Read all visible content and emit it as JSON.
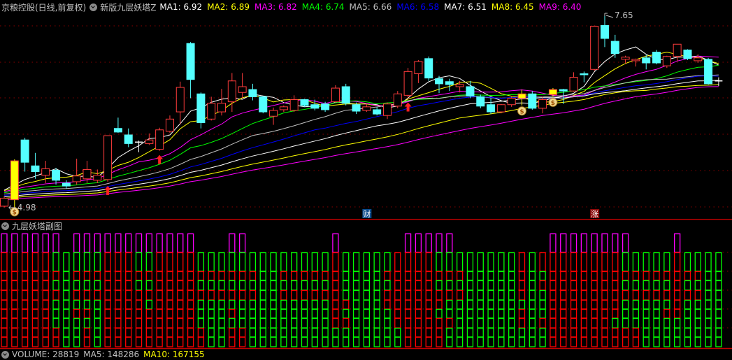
{
  "header": {
    "stock_title": "京粮控股(日线,前复权)",
    "indicator_name": "新版九层妖塔Z",
    "ma": [
      {
        "label": "MA1: 6.92",
        "color": "#ffffff"
      },
      {
        "label": "MA2: 6.89",
        "color": "#ffff00"
      },
      {
        "label": "MA3: 6.82",
        "color": "#ff00ff"
      },
      {
        "label": "MA4: 6.74",
        "color": "#00ff00"
      },
      {
        "label": "MA5: 6.66",
        "color": "#c0c0c0"
      },
      {
        "label": "MA6: 6.58",
        "color": "#0000ff"
      },
      {
        "label": "MA7: 6.51",
        "color": "#ffffff"
      },
      {
        "label": "MA8: 6.45",
        "color": "#ffff00"
      },
      {
        "label": "MA9: 6.40",
        "color": "#ff00ff"
      }
    ]
  },
  "main_chart": {
    "high_label": "7.65",
    "low_label": "4.98",
    "price_range": [
      4.95,
      7.86
    ],
    "ma_periods": [
      5,
      8,
      13,
      18,
      24,
      30,
      36,
      44,
      52
    ],
    "candles": [
      [
        5.0,
        5.14,
        4.98,
        5.11
      ],
      [
        5.09,
        5.65,
        4.98,
        5.63
      ],
      [
        5.92,
        5.95,
        5.48,
        5.61
      ],
      [
        5.56,
        5.74,
        5.38,
        5.48
      ],
      [
        5.43,
        5.63,
        5.32,
        5.52
      ],
      [
        5.5,
        5.53,
        5.3,
        5.36
      ],
      [
        5.32,
        5.36,
        5.24,
        5.28
      ],
      [
        5.34,
        5.66,
        5.3,
        5.42
      ],
      [
        5.38,
        5.63,
        5.32,
        5.51
      ],
      [
        5.36,
        5.51,
        5.32,
        5.43
      ],
      [
        5.37,
        5.98,
        5.34,
        5.98
      ],
      [
        6.08,
        6.23,
        6.02,
        6.03
      ],
      [
        5.99,
        6.08,
        5.82,
        5.87
      ],
      [
        5.89,
        5.91,
        5.75,
        5.89
      ],
      [
        5.87,
        6.01,
        5.85,
        5.92
      ],
      [
        5.79,
        6.09,
        5.77,
        6.06
      ],
      [
        6.04,
        6.26,
        6.02,
        6.21
      ],
      [
        6.31,
        6.73,
        6.14,
        6.65
      ],
      [
        7.26,
        7.28,
        6.5,
        6.76
      ],
      [
        6.56,
        6.58,
        6.08,
        6.16
      ],
      [
        6.21,
        6.52,
        6.19,
        6.43
      ],
      [
        6.31,
        6.63,
        6.26,
        6.43
      ],
      [
        6.45,
        6.85,
        6.31,
        6.74
      ],
      [
        6.58,
        6.85,
        6.5,
        6.66
      ],
      [
        6.62,
        6.7,
        6.47,
        6.52
      ],
      [
        6.52,
        6.53,
        6.29,
        6.31
      ],
      [
        6.25,
        6.37,
        6.13,
        6.33
      ],
      [
        6.34,
        6.4,
        6.31,
        6.38
      ],
      [
        6.33,
        6.54,
        6.31,
        6.48
      ],
      [
        6.48,
        6.49,
        6.38,
        6.4
      ],
      [
        6.41,
        6.48,
        6.33,
        6.36
      ],
      [
        6.42,
        6.45,
        6.31,
        6.34
      ],
      [
        6.45,
        6.68,
        6.44,
        6.64
      ],
      [
        6.66,
        6.7,
        6.4,
        6.43
      ],
      [
        6.41,
        6.44,
        6.28,
        6.32
      ],
      [
        6.33,
        6.42,
        6.31,
        6.38
      ],
      [
        6.34,
        6.38,
        6.26,
        6.28
      ],
      [
        6.26,
        6.44,
        6.21,
        6.42
      ],
      [
        6.39,
        6.6,
        6.36,
        6.56
      ],
      [
        6.54,
        6.92,
        6.5,
        6.87
      ],
      [
        6.84,
        7.03,
        6.71,
        7.01
      ],
      [
        7.05,
        7.08,
        6.74,
        6.78
      ],
      [
        6.77,
        6.81,
        6.57,
        6.7
      ],
      [
        6.73,
        6.77,
        6.6,
        6.69
      ],
      [
        6.66,
        6.74,
        6.58,
        6.69
      ],
      [
        6.66,
        6.74,
        6.5,
        6.53
      ],
      [
        6.52,
        6.55,
        6.36,
        6.39
      ],
      [
        6.41,
        6.5,
        6.28,
        6.31
      ],
      [
        6.31,
        6.42,
        6.29,
        6.41
      ],
      [
        6.41,
        6.52,
        6.38,
        6.5
      ],
      [
        6.5,
        6.62,
        6.4,
        6.56
      ],
      [
        6.56,
        6.6,
        6.34,
        6.36
      ],
      [
        6.36,
        6.52,
        6.29,
        6.48
      ],
      [
        6.55,
        6.64,
        6.52,
        6.62
      ],
      [
        6.62,
        6.63,
        6.42,
        6.6
      ],
      [
        6.6,
        6.86,
        6.59,
        6.79
      ],
      [
        6.84,
        6.87,
        6.72,
        6.83
      ],
      [
        6.9,
        7.51,
        6.88,
        7.5
      ],
      [
        7.51,
        7.65,
        7.21,
        7.33
      ],
      [
        7.29,
        7.38,
        7.06,
        7.12
      ],
      [
        7.04,
        7.09,
        6.98,
        7.07
      ],
      [
        7.02,
        7.05,
        6.94,
        7.04
      ],
      [
        7.06,
        7.1,
        6.9,
        6.99
      ],
      [
        7.14,
        7.17,
        6.97,
        6.99
      ],
      [
        6.95,
        7.09,
        6.92,
        7.08
      ],
      [
        7.08,
        7.25,
        7.01,
        7.25
      ],
      [
        7.17,
        7.18,
        7.03,
        7.05
      ],
      [
        7.02,
        7.11,
        6.99,
        7.06
      ],
      [
        7.04,
        7.06,
        6.69,
        6.7
      ],
      [
        6.74,
        6.79,
        6.67,
        6.74
      ]
    ],
    "limit_up_candles": [
      1,
      50,
      53
    ],
    "buy_arrows": [
      10,
      15,
      39
    ],
    "money_bag_markers": [
      1,
      50,
      53
    ],
    "text_markers": [
      {
        "index": 35,
        "text": "财",
        "color": "#0a4a8a"
      },
      {
        "index": 57,
        "text": "涨",
        "color": "#8a0a0a"
      }
    ],
    "colors": {
      "up": "#ff3c3c",
      "down": "#54ffff",
      "limit": "#ffff00",
      "grid": "#8a0000"
    }
  },
  "sub_chart": {
    "title": "九层妖塔副图",
    "columns": [
      "MRRRRRRRRR",
      "MRRRRRRRRR",
      "MRRRRRRRRR",
      "MRRRRRRRRR",
      "MRRRRRRRRR",
      "MGRGRGGGRR",
      "-GGGGGGGGG",
      "MGRGRGRGGG",
      "MGRGRGRGRR",
      "MGRGRGGGGG",
      "MRRRRRRRRR",
      "MRRRRRRRRR",
      "MRRRRRRRRR",
      "MGRGRRRRRR",
      "MGRGRGRRRR",
      "MRRRRRRRRR",
      "MRRRRRRRRR",
      "MRRRRRRRRR",
      "MRRRRRRRRR",
      "-GRGRGGGRR",
      "-GRGRGGGGG",
      "-GRGRGGGGG",
      "MGRGRGRGRR",
      "MGRGRGGGRR",
      "-GRGRGGGGG",
      "-GGGGGGGGG",
      "-GGGGGGGGG",
      "-GRGRGGGGG",
      "-GRGRGGGGG",
      "-GRGRGGGGG",
      "-GRGRGGGGG",
      "-GRGRGGGGG",
      "MRRRRRRRGG",
      "-GGGGRGRGG",
      "-GGGGGGGGG",
      "-GGGGGGGGG",
      "-GGGGGGGGG",
      "-GRGRRGGGG",
      "-RRRRRRRGG",
      "MRRRRRRRRR",
      "MRRRRRRRRR",
      "MRRRRRRRRR",
      "MGRGRRGRRR",
      "MGRGRGGRGG",
      "-GRGRGGGGG",
      "-GGGGGGGGG",
      "-GGGGGGGGG",
      "-GGGGGGGGG",
      "-GGGGGGGGG",
      "-GGGGGGGGG",
      "-RRRRGRRGG",
      "-GGGGGGGGG",
      "-RGRGGGRGG",
      "MRRRRRRRRR",
      "MRRRRRRRRR",
      "MRRRRRRRRR",
      "MRRRRRRRRR",
      "MRRRRRRRRR",
      "MRRRRRRRRR",
      "MRRRRRRGRR",
      "MGRGRGGGRR",
      "-GRGRGGGRR",
      "-GRGRGGGGG",
      "-GRGRGGGGG",
      "-GRGRGRGGG",
      "MRRRRRRGGG",
      "-GRGRGGGGG",
      "-GRGRGGGGG",
      "-GGGGGGGGG",
      "-GGGGGGGGG"
    ],
    "colors": {
      "M": "#ff00ff",
      "R": "#ff0000",
      "G": "#00ff00"
    }
  },
  "volume_header": {
    "volume": "VOLUME: 28819",
    "ma5": "MA5: 148286",
    "ma10": "MA10: 167155"
  }
}
